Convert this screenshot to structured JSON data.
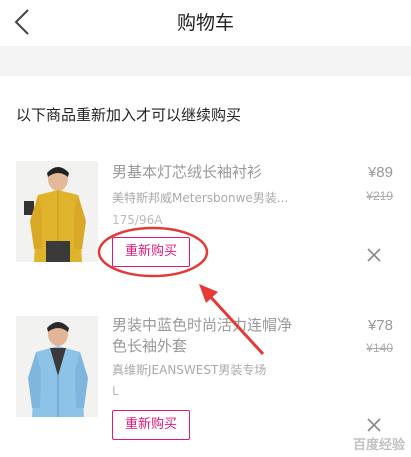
{
  "header": {
    "title": "购物车"
  },
  "section_title": "以下商品重新加入才可以继续购买",
  "items": [
    {
      "name": "男基本灯芯绒长袖衬衫",
      "store": "美特斯邦威Metersbonwe男装...",
      "spec": "175/96A",
      "price": "¥89",
      "original_price": "¥219",
      "rebuy_label": "重新购买"
    },
    {
      "name_line1": "男装中蓝色时尚活力连帽净",
      "name_line2": "色长袖外套",
      "store": "真维斯JEANSWEST男装专场",
      "spec": "L",
      "price": "¥78",
      "original_price": "¥140",
      "rebuy_label": "重新购买"
    }
  ],
  "watermark": "百度经验",
  "colors": {
    "accent": "#e0187b",
    "annotation": "#e53935"
  }
}
